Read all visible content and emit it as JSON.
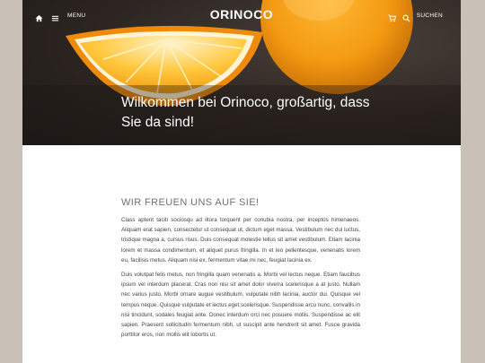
{
  "colors": {
    "side_background": "#c9c0b8",
    "page_background": "#ffffff",
    "accent_orange": "#f7a21b"
  },
  "header": {
    "menu_label": "MENU",
    "logo": "ORINOCO",
    "search_label": "SUCHEN",
    "icons": [
      "home-icon",
      "hamburger-menu-icon",
      "cart-icon",
      "search-icon"
    ]
  },
  "hero": {
    "title": "Wilkommen bei Orinoco, großartig, dass Sie da sind!"
  },
  "main": {
    "heading": "WIR FREUEN UNS AUF SIE!",
    "paragraphs": [
      "Class aptent taciti sociosqu ad litora torquent per conubia nostra, per inceptos himenaeos. Aliquam erat sapien, consectetur ut consequat ut, dictum eget massa. Vestibulum nec dui luctus, tristique magna a, cursus risus. Duis consequat molestie tellus sit amet vestibulum. Etiam lacinia lorem et massa condimentum, et aliquet purus fringilla. In et leo pellentesque, venenatis lorem eu, facilisis metus. Aliquam nisi ex, fermentum vitae mi nec, feugiat lacinia ex.",
      "Duis volutpat felis metus, non fringilla quam venenatis a. Morbi vel lectus neque. Etiam faucibus ipsum vel interdum placerat. Cras non nisi sit amet dolor viverra scelerisque a at justo. Nullam nec varius justo. Morbi ornare augue vestibulum, vulputate nibh lacinia, auctor dui. Quisque vel tempus neque. Quisque vulputate et lectus eget scelerisque. Suspendisse arcu nunc, convallis in nisi tincidunt, sodales feugiat ante. Donec interdum orci nec posuere mollis. Suspendisse ac elit sapien. Praesent sollicitudin fermentum nibh, ut suscipit ante hendrerit sit amet. Fusce gravida porttitor eros, non mollis elit lobortis ut."
    ]
  }
}
